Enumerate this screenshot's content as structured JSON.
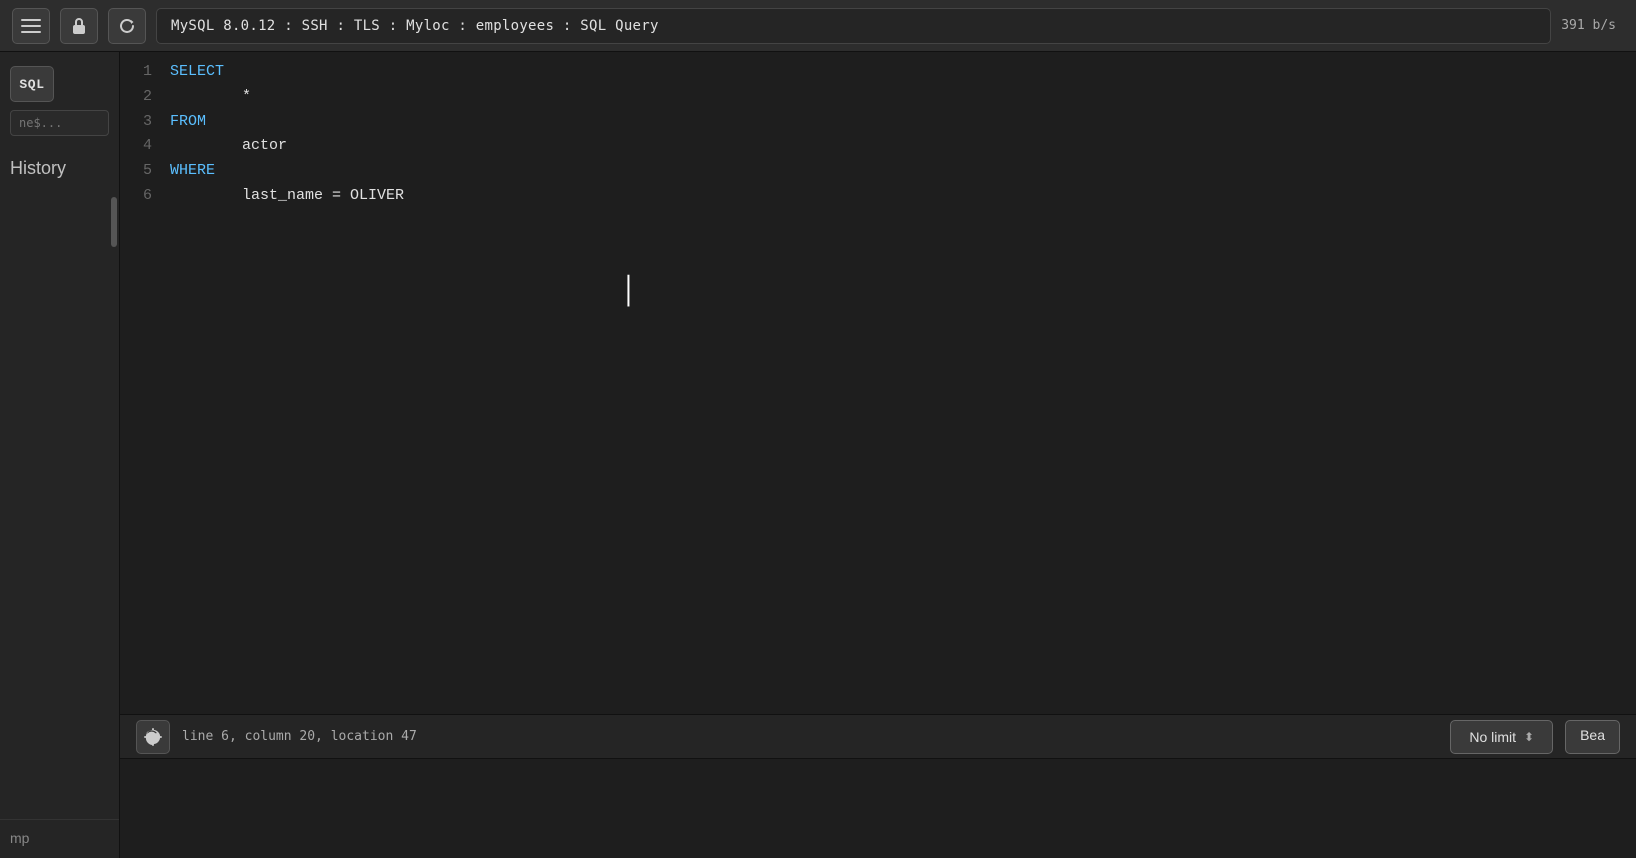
{
  "toolbar": {
    "title": "MySQL 8.0.12 : SSH : TLS : Myloc : employees : SQL Query",
    "right_text": "391 b/s",
    "refresh_icon": "↺",
    "menu_icon": "≡",
    "lock_icon": "🔓"
  },
  "sidebar": {
    "sql_label": "SQL",
    "search_placeholder": "ne$...",
    "history_label": "History",
    "bottom_label": "mp"
  },
  "editor": {
    "lines": [
      {
        "num": "1",
        "tokens": [
          {
            "type": "kw",
            "text": "SELECT"
          }
        ]
      },
      {
        "num": "2",
        "tokens": [
          {
            "type": "plain",
            "text": "        *"
          }
        ]
      },
      {
        "num": "3",
        "tokens": [
          {
            "type": "kw",
            "text": "FROM"
          }
        ]
      },
      {
        "num": "4",
        "tokens": [
          {
            "type": "plain",
            "text": "        actor"
          }
        ]
      },
      {
        "num": "5",
        "tokens": [
          {
            "type": "kw",
            "text": "WHERE"
          }
        ]
      },
      {
        "num": "6",
        "tokens": [
          {
            "type": "plain",
            "text": "        last_name = OLIVER"
          }
        ]
      }
    ]
  },
  "statusbar": {
    "position_text": "line 6, column 20, location 47",
    "no_limit_label": "No limit",
    "bea_label": "Bea"
  }
}
